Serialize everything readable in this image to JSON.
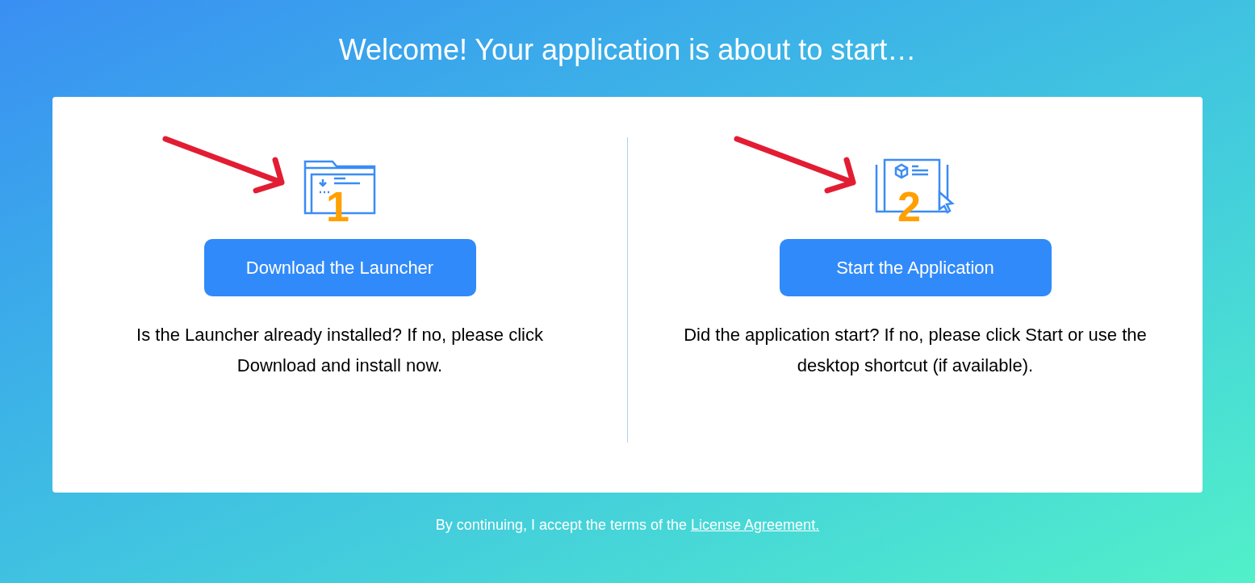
{
  "heading": "Welcome! Your application is about to start…",
  "steps": [
    {
      "kind": "download",
      "number": "1",
      "button": "Download the Launcher",
      "description": "Is the Launcher already installed? If no, please click Download and install now."
    },
    {
      "kind": "start",
      "number": "2",
      "button": "Start the Application",
      "description": "Did the application start? If no, please click Start or use the desktop shortcut (if available)."
    }
  ],
  "footer": {
    "text": "By continuing, I accept the terms of the",
    "link": "License Agreement."
  }
}
